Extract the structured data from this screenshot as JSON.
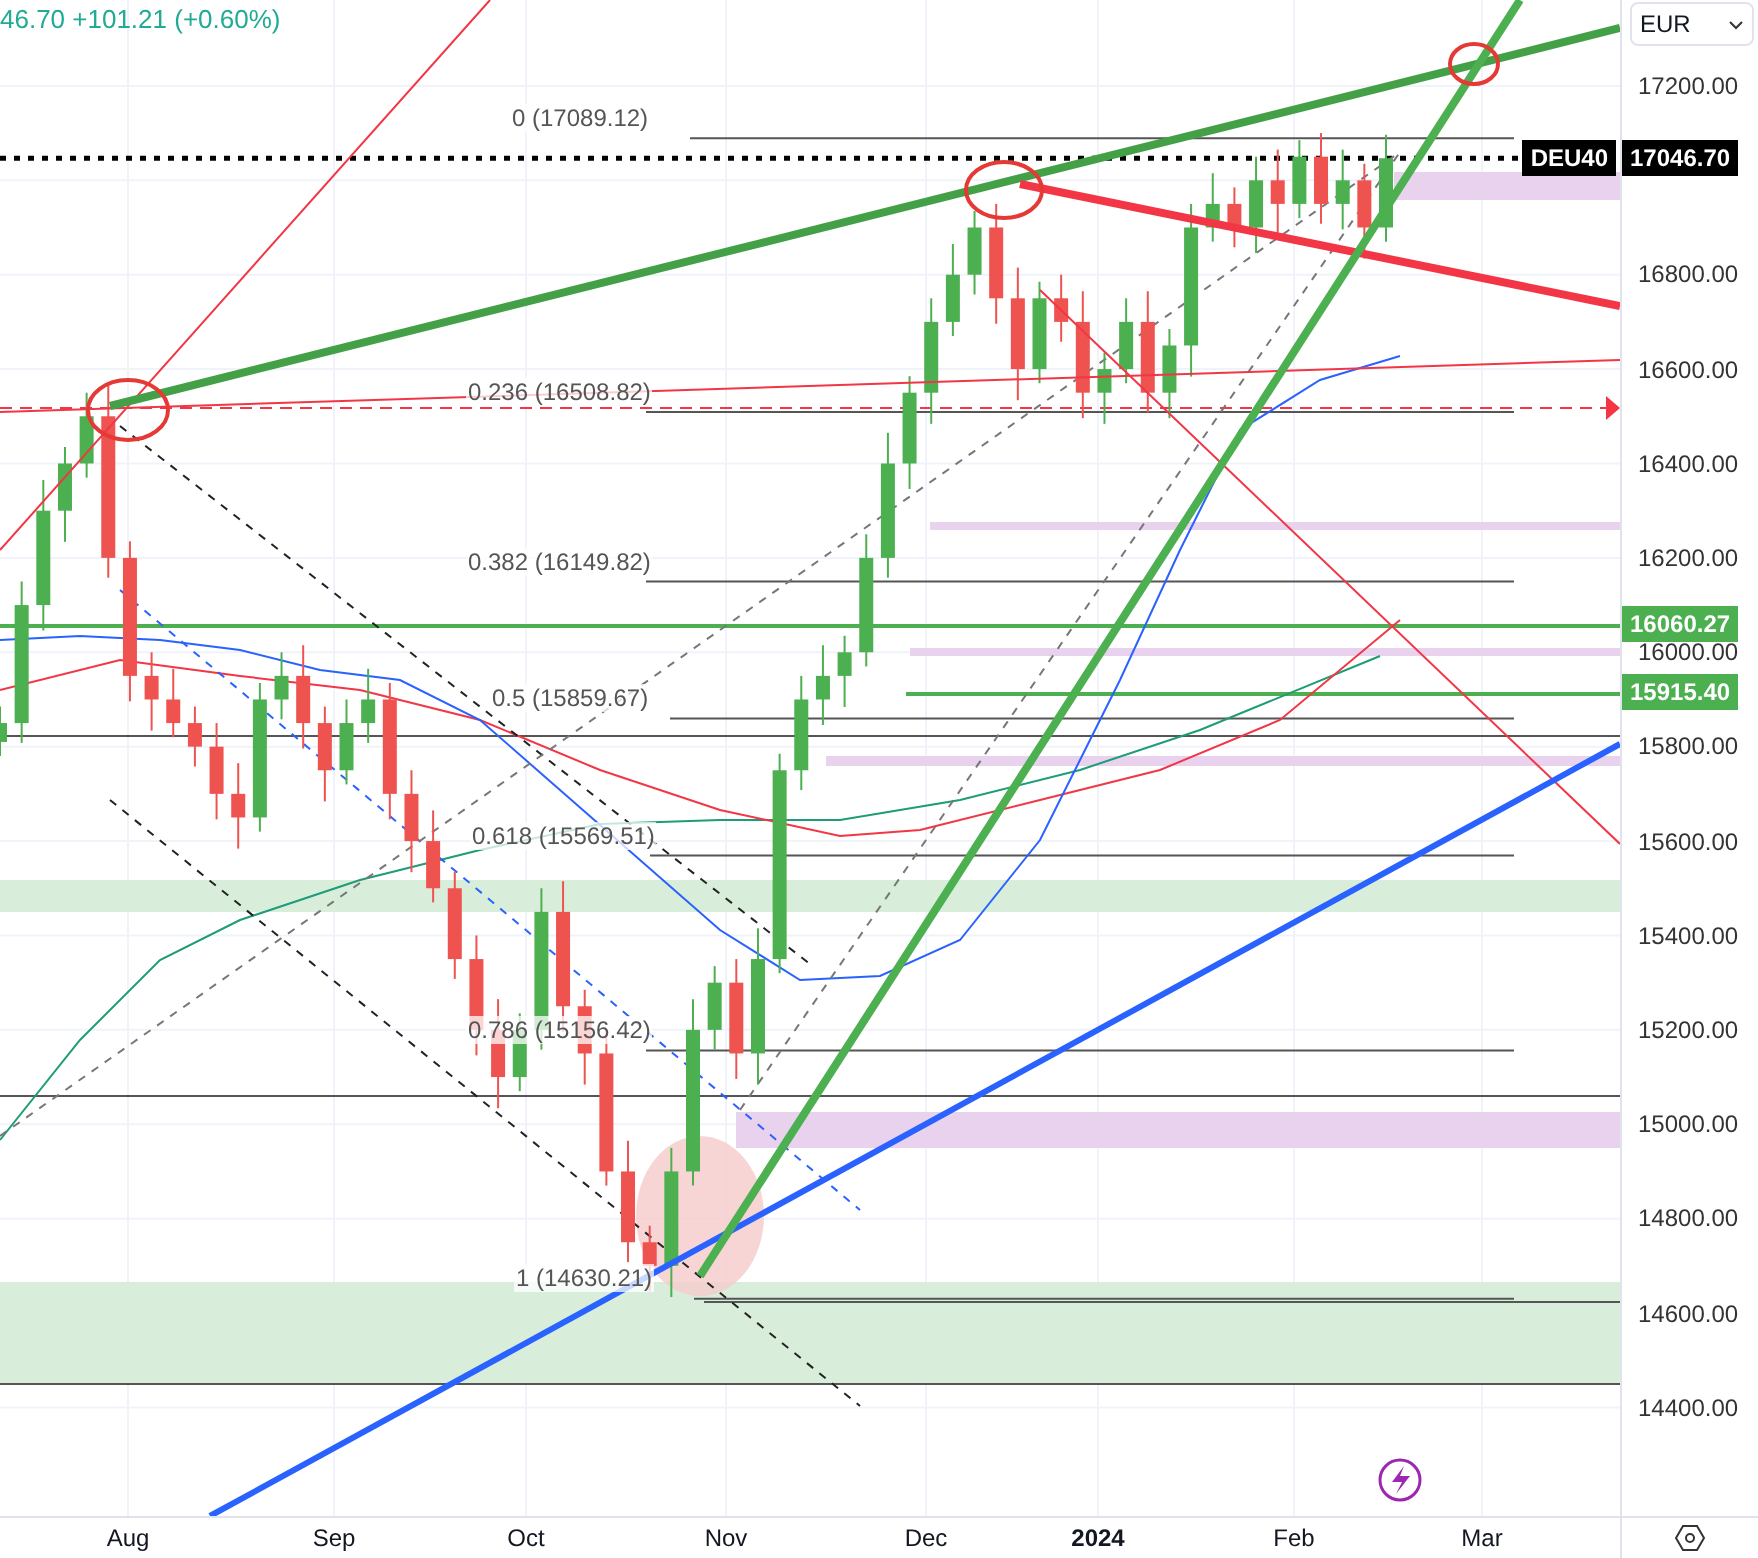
{
  "quote": {
    "text": "46.70 +101.21 (+0.60%)"
  },
  "currency_menu": {
    "label": "EUR"
  },
  "fib_levels": [
    {
      "label": "0 (17089.12)"
    },
    {
      "label": "0.236 (16508.82)"
    },
    {
      "label": "0.382 (16149.82)"
    },
    {
      "label": "0.5 (15859.67)"
    },
    {
      "label": "0.618 (15569.51)"
    },
    {
      "label": "0.786 (15156.42)"
    },
    {
      "label": "1 (14630.21)"
    }
  ],
  "price_tags": [
    {
      "kind": "symbol",
      "label": "DEU40"
    },
    {
      "kind": "last",
      "label": "17046.70"
    },
    {
      "kind": "level",
      "label": "16060.27"
    },
    {
      "kind": "level",
      "label": "15915.40"
    }
  ],
  "price_axis": [
    "17200.00",
    "16800.00",
    "16600.00",
    "16400.00",
    "16200.00",
    "16000.00",
    "15800.00",
    "15600.00",
    "15400.00",
    "15200.00",
    "15000.00",
    "14800.00",
    "14600.00",
    "14400.00"
  ],
  "time_axis": [
    {
      "label": "Aug",
      "bold": false
    },
    {
      "label": "Sep",
      "bold": false
    },
    {
      "label": "Oct",
      "bold": false
    },
    {
      "label": "Nov",
      "bold": false
    },
    {
      "label": "Dec",
      "bold": false
    },
    {
      "label": "2024",
      "bold": true
    },
    {
      "label": "Feb",
      "bold": false
    },
    {
      "label": "Mar",
      "bold": false
    }
  ]
}
